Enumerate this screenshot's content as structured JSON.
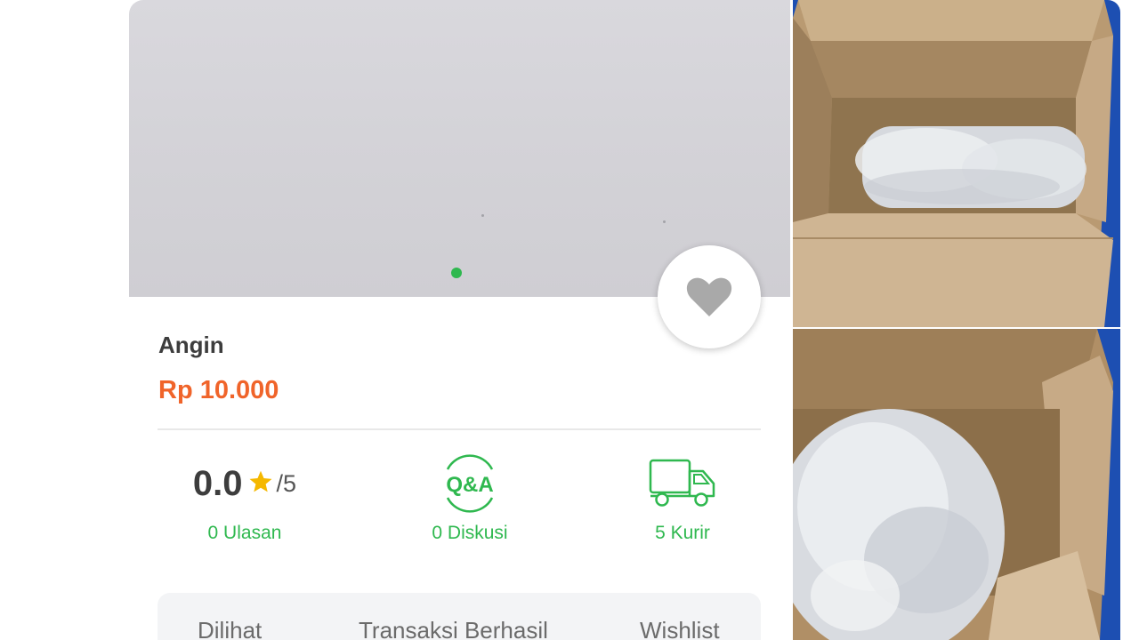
{
  "product": {
    "name": "Angin",
    "price": "Rp 10.000"
  },
  "stats": {
    "rating_value": "0.0",
    "rating_max": "/5",
    "reviews_label": "0 Ulasan",
    "qa_icon_text": "Q&A",
    "discussions_label": "0 Diskusi",
    "couriers_label": "5 Kurir"
  },
  "info_bar": {
    "views_label": "Dilihat",
    "transactions_label": "Transaksi Berhasil",
    "wishlist_label": "Wishlist"
  },
  "carousel": {
    "active_index": 1,
    "count": 1
  },
  "icons": {
    "wishlist": "heart-icon",
    "rating": "star-icon",
    "discussion": "qa-icon",
    "courier": "truck-icon"
  },
  "colors": {
    "price": "#f0642a",
    "accent_green": "#2fb84f",
    "star": "#f5b800",
    "heart": "#a9a9a9"
  }
}
